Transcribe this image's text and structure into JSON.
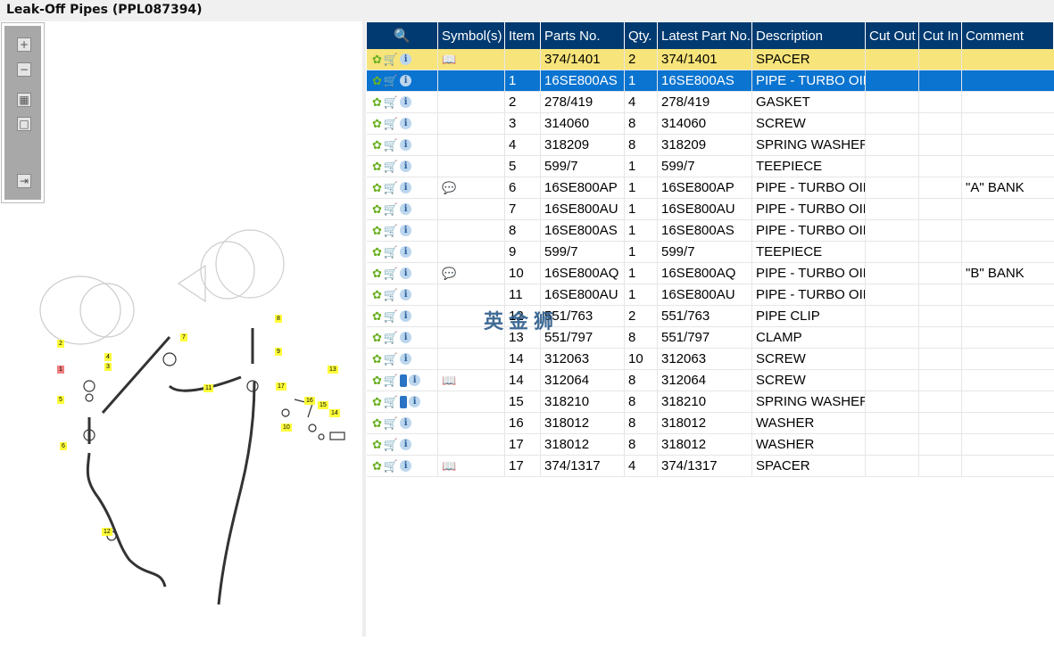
{
  "title": "Leak-Off Pipes (PPL087394)",
  "toolbar": {
    "zoom_in": "+",
    "zoom_out": "−",
    "fit": "▦",
    "actual": "□",
    "export": "⇥"
  },
  "diagram_labels": [
    "1",
    "2",
    "3",
    "4",
    "5",
    "6",
    "7",
    "8",
    "9",
    "10",
    "11",
    "12",
    "13",
    "14",
    "15",
    "16",
    "17"
  ],
  "headers": [
    "Symbol(s)",
    "Item",
    "Parts No.",
    "Qty.",
    "Latest Part No.",
    "Description",
    "Cut Out",
    "Cut In",
    "Comment"
  ],
  "watermark": "英金狮",
  "rows": [
    {
      "state": "yellow",
      "book": false,
      "symbol": "book-search",
      "item": "",
      "part": "374/1401",
      "qty": "2",
      "latest": "374/1401",
      "desc": "SPACER",
      "comment": ""
    },
    {
      "state": "sel",
      "book": false,
      "symbol": "",
      "item": "1",
      "part": "16SE800AS",
      "qty": "1",
      "latest": "16SE800AS",
      "desc": "PIPE - TURBO OIL I",
      "comment": ""
    },
    {
      "state": "",
      "book": false,
      "symbol": "",
      "item": "2",
      "part": "278/419",
      "qty": "4",
      "latest": "278/419",
      "desc": "GASKET",
      "comment": ""
    },
    {
      "state": "",
      "book": false,
      "symbol": "",
      "item": "3",
      "part": "314060",
      "qty": "8",
      "latest": "314060",
      "desc": "SCREW",
      "comment": ""
    },
    {
      "state": "",
      "book": false,
      "symbol": "",
      "item": "4",
      "part": "318209",
      "qty": "8",
      "latest": "318209",
      "desc": "SPRING WASHER",
      "comment": ""
    },
    {
      "state": "",
      "book": false,
      "symbol": "",
      "item": "5",
      "part": "599/7",
      "qty": "1",
      "latest": "599/7",
      "desc": "TEEPIECE",
      "comment": ""
    },
    {
      "state": "",
      "book": false,
      "symbol": "comment",
      "item": "6",
      "part": "16SE800AP",
      "qty": "1",
      "latest": "16SE800AP",
      "desc": "PIPE - TURBO OIL I",
      "comment": "\"A\" BANK"
    },
    {
      "state": "",
      "book": false,
      "symbol": "",
      "item": "7",
      "part": "16SE800AU",
      "qty": "1",
      "latest": "16SE800AU",
      "desc": "PIPE - TURBO OIL I",
      "comment": ""
    },
    {
      "state": "",
      "book": false,
      "symbol": "",
      "item": "8",
      "part": "16SE800AS",
      "qty": "1",
      "latest": "16SE800AS",
      "desc": "PIPE - TURBO OIL I",
      "comment": ""
    },
    {
      "state": "",
      "book": false,
      "symbol": "",
      "item": "9",
      "part": "599/7",
      "qty": "1",
      "latest": "599/7",
      "desc": "TEEPIECE",
      "comment": ""
    },
    {
      "state": "",
      "book": false,
      "symbol": "comment",
      "item": "10",
      "part": "16SE800AQ",
      "qty": "1",
      "latest": "16SE800AQ",
      "desc": "PIPE - TURBO OIL I",
      "comment": "\"B\" BANK"
    },
    {
      "state": "",
      "book": false,
      "symbol": "",
      "item": "11",
      "part": "16SE800AU",
      "qty": "1",
      "latest": "16SE800AU",
      "desc": "PIPE - TURBO OIL I",
      "comment": ""
    },
    {
      "state": "",
      "book": false,
      "symbol": "",
      "item": "12",
      "part": "551/763",
      "qty": "2",
      "latest": "551/763",
      "desc": "PIPE CLIP",
      "comment": ""
    },
    {
      "state": "",
      "book": false,
      "symbol": "",
      "item": "13",
      "part": "551/797",
      "qty": "8",
      "latest": "551/797",
      "desc": "CLAMP",
      "comment": ""
    },
    {
      "state": "",
      "book": false,
      "symbol": "",
      "item": "14",
      "part": "312063",
      "qty": "10",
      "latest": "312063",
      "desc": "SCREW",
      "comment": ""
    },
    {
      "state": "",
      "book": true,
      "symbol": "book-search",
      "item": "14",
      "part": "312064",
      "qty": "8",
      "latest": "312064",
      "desc": "SCREW",
      "comment": ""
    },
    {
      "state": "",
      "book": true,
      "symbol": "",
      "item": "15",
      "part": "318210",
      "qty": "8",
      "latest": "318210",
      "desc": "SPRING WASHER",
      "comment": ""
    },
    {
      "state": "",
      "book": false,
      "symbol": "",
      "item": "16",
      "part": "318012",
      "qty": "8",
      "latest": "318012",
      "desc": "WASHER",
      "comment": ""
    },
    {
      "state": "",
      "book": false,
      "symbol": "",
      "item": "17",
      "part": "318012",
      "qty": "8",
      "latest": "318012",
      "desc": "WASHER",
      "comment": ""
    },
    {
      "state": "",
      "book": false,
      "symbol": "book-search",
      "item": "17",
      "part": "374/1317",
      "qty": "4",
      "latest": "374/1317",
      "desc": "SPACER",
      "comment": ""
    }
  ]
}
